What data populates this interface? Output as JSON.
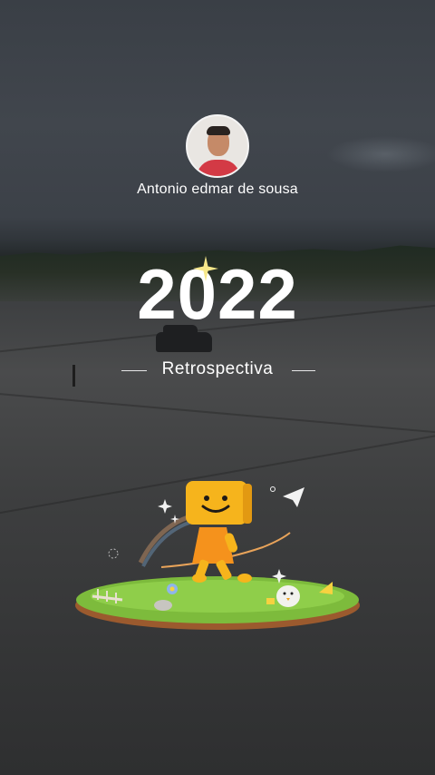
{
  "profile": {
    "user_name": "Antonio edmar de sousa"
  },
  "hero": {
    "year": "2022",
    "subtitle": "Retrospectiva"
  },
  "colors": {
    "text": "#ffffff",
    "sparkle": "#f7e88a",
    "mascot": "#f6b41c",
    "grass": "#7dbb3c"
  },
  "icons": {
    "sparkle": "sparkle-icon",
    "paper_plane": "paper-plane-icon"
  }
}
